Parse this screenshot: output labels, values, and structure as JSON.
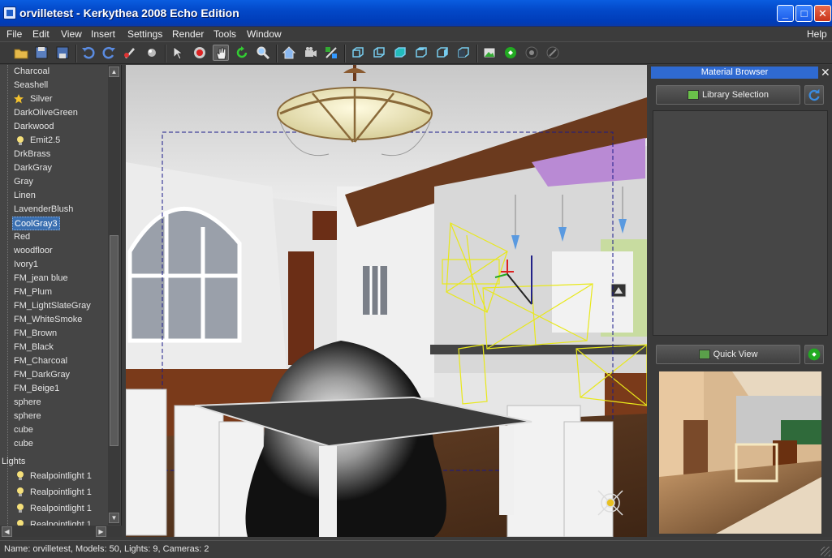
{
  "window": {
    "title": "orvilletest - Kerkythea 2008 Echo Edition",
    "controls": [
      "minimize",
      "maximize",
      "close"
    ]
  },
  "menu": {
    "items": [
      "File",
      "Edit",
      "View",
      "Insert",
      "Settings",
      "Render",
      "Tools",
      "Window"
    ],
    "help": "Help"
  },
  "toolbar": {
    "icons": [
      "open-folder-icon",
      "save-icon",
      "save-as-icon",
      "undo-icon",
      "redo-icon",
      "paint-icon",
      "sphere-icon",
      "select-arrow-icon",
      "target-icon",
      "pan-hand-icon",
      "rotate-icon",
      "zoom-icon",
      "home-icon",
      "camera-icon",
      "transform-icon",
      "view-cube-front-icon",
      "view-cube-back-icon",
      "view-cube-top-icon",
      "view-cube-bottom-icon",
      "view-cube-left-icon",
      "view-cube-right-icon",
      "render-photo-icon",
      "render-start-icon",
      "render-gear-icon",
      "render-stop-icon"
    ]
  },
  "scene_tree": {
    "items": [
      {
        "label": "Charcoal",
        "icon": ""
      },
      {
        "label": "Seashell",
        "icon": ""
      },
      {
        "label": "Silver",
        "icon": "star-icon"
      },
      {
        "label": "DarkOliveGreen",
        "icon": ""
      },
      {
        "label": "Darkwood",
        "icon": ""
      },
      {
        "label": "Emit2.5",
        "icon": "bulb-icon"
      },
      {
        "label": "DrkBrass",
        "icon": ""
      },
      {
        "label": "DarkGray",
        "icon": ""
      },
      {
        "label": "Gray",
        "icon": ""
      },
      {
        "label": "Linen",
        "icon": ""
      },
      {
        "label": "LavenderBlush",
        "icon": ""
      },
      {
        "label": "CoolGray3",
        "icon": "",
        "selected": true
      },
      {
        "label": "Red",
        "icon": ""
      },
      {
        "label": "woodfloor",
        "icon": ""
      },
      {
        "label": "Ivory1",
        "icon": ""
      },
      {
        "label": "FM_jean blue",
        "icon": ""
      },
      {
        "label": "FM_Plum",
        "icon": ""
      },
      {
        "label": "FM_LightSlateGray",
        "icon": ""
      },
      {
        "label": "FM_WhiteSmoke",
        "icon": ""
      },
      {
        "label": "FM_Brown",
        "icon": ""
      },
      {
        "label": "FM_Black",
        "icon": ""
      },
      {
        "label": "FM_Charcoal",
        "icon": ""
      },
      {
        "label": "FM_DarkGray",
        "icon": ""
      },
      {
        "label": "FM_Beige1",
        "icon": ""
      },
      {
        "label": "sphere",
        "icon": ""
      },
      {
        "label": "sphere",
        "icon": ""
      },
      {
        "label": "cube",
        "icon": ""
      },
      {
        "label": "cube",
        "icon": ""
      }
    ],
    "lights_group": "Lights",
    "lights": [
      "Realpointlight 1",
      "Realpointlight 1",
      "Realpointlight 1",
      "Realpointlight 1"
    ]
  },
  "material_browser": {
    "title": "Material Browser",
    "library_button": "Library Selection",
    "quick_view_button": "Quick View"
  },
  "status": {
    "text": "Name: orvilletest, Models: 50, Lights: 9, Cameras: 2"
  },
  "colors": {
    "selection": "#3a6fb0",
    "titlebar": "#0348c8",
    "panel_header": "#2f6ad1",
    "wireframe": "#e8e81a",
    "beam": "#6b3a1e"
  }
}
